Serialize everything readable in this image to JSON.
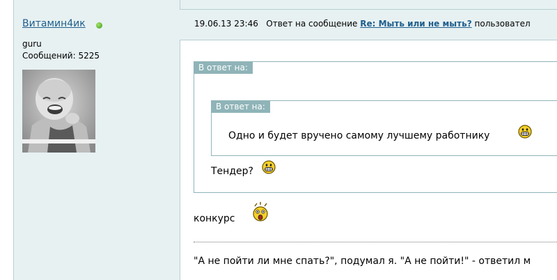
{
  "author": {
    "name": "Витамин4ик",
    "rank": "guru",
    "posts_label": "Сообщений: 5225",
    "online_color": "#3a9a1a"
  },
  "post_header": {
    "datetime": "19.06.13 23:46",
    "reply_prefix": "Ответ на сообщение",
    "reply_link": "Re: Мыть или не мыть?",
    "reply_suffix": "пользовател"
  },
  "quotes": {
    "outer_label": "В ответ на:",
    "inner_label": "В ответ на:",
    "inner_text": "Одно и будет вручено самому лучшему работнику",
    "outer_text": "Тендер?"
  },
  "post_body": "конкурс",
  "signature": "\"А не пойти ли мне спать?\", подумал я. \"А не пойти!\" - ответил м",
  "icons": {
    "online": "online-status-icon",
    "grin": "grin-smiley-icon",
    "shock": "shocked-smiley-icon"
  },
  "colors": {
    "link": "#1f5e8c",
    "panel_bg": "#e7f1f2",
    "quote_border": "#8fb4b8"
  }
}
